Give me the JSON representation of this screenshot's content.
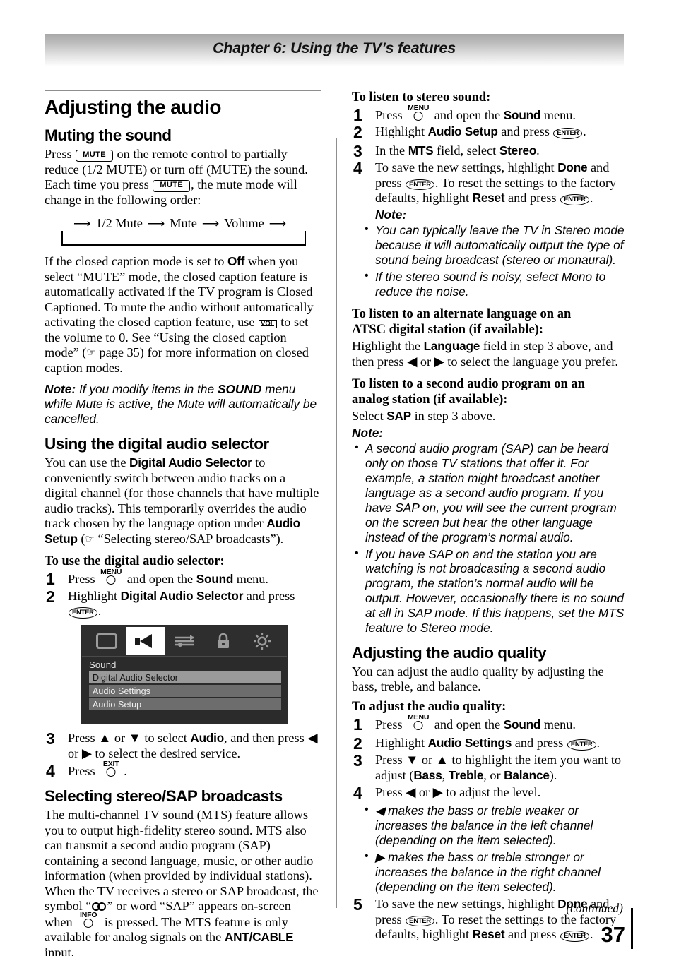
{
  "header": {
    "chapter_title": "Chapter 6: Using the TV’s features"
  },
  "left": {
    "section_title": "Adjusting the audio",
    "muting": {
      "heading": "Muting the sound",
      "p1_a": "Press",
      "key_mute": "MUTE",
      "p1_b": "on the remote control to partially reduce (1/2 MUTE) or turn off (MUTE) the sound. Each time you press",
      "p1_c": ", the mute mode will change in the following order:",
      "cycle": [
        "1/2 Mute",
        "Mute",
        "Volume"
      ],
      "p2_a": "If the closed caption mode is set to",
      "p2_off": "Off",
      "p2_b": "when you select “MUTE” mode, the closed caption feature is automatically activated if the TV program is Closed Captioned. To mute the audio without automatically activating the closed caption feature, use",
      "key_vol": "VOL",
      "p2_c": "to set the volume to 0. See “Using the closed caption mode” (",
      "p2_d": "page 35) for more information on closed caption modes.",
      "note_label": "Note:",
      "note_a": "If you modify items in the",
      "note_b": "SOUND",
      "note_c": "menu while Mute is active, the Mute will automatically be cancelled."
    },
    "selector": {
      "heading": "Using the digital audio selector",
      "p1_a": "You can use the",
      "p1_b": "Digital Audio Selector",
      "p1_c": "to conveniently switch between audio tracks on a digital channel (for those channels that have multiple audio tracks). This temporarily overrides the audio track chosen by the language option under",
      "p1_d": "Audio Setup",
      "p1_e": "(",
      "p1_f": "“Selecting stereo/SAP broadcasts”).",
      "task_heading": "To use the digital audio selector:",
      "step1_a": "Press",
      "step1_key": "MENU",
      "step1_b": "and open the",
      "step1_bold": "Sound",
      "step1_c": "menu.",
      "step2_a": "Highlight",
      "step2_bold": "Digital Audio Selector",
      "step2_b": "and press",
      "key_enter": "ENTER",
      "step2_c": ".",
      "step3_a": "Press",
      "step3_b": "or",
      "step3_c": "to select",
      "step3_bold": "Audio",
      "step3_d": ", and then press",
      "step3_e": "or",
      "step3_f": "to select the desired service.",
      "step4_a": "Press",
      "step4_key": "EXIT",
      "step4_b": "."
    },
    "osd": {
      "icons": [
        "picture-icon",
        "sound-icon",
        "settings-icon",
        "lock-icon",
        "brightness-icon"
      ],
      "active_icon_index": 1,
      "menu_title": "Sound",
      "rows": [
        "Digital Audio Selector",
        "Audio Settings",
        "Audio Setup"
      ],
      "selected_row_index": 0
    },
    "stereo_sap": {
      "heading": "Selecting stereo/SAP broadcasts",
      "p1_a": "The multi-channel TV sound (MTS) feature allows you to output high-fidelity stereo sound. MTS also can transmit a second audio program (SAP) containing a second language, music, or other audio information (when provided by individual stations). When the TV receives a stereo or SAP broadcast, the symbol “",
      "p1_b": "” or word “SAP” appears on-screen when",
      "info_key": "INFO",
      "p1_c": "is pressed. The MTS feature is only available for analog signals on the",
      "p1_bold": "ANT/CABLE",
      "p1_d": "input."
    }
  },
  "right": {
    "stereo_task": {
      "heading": "To listen to stereo sound:",
      "step1_a": "Press",
      "step1_key": "MENU",
      "step1_b": "and open the",
      "step1_bold": "Sound",
      "step1_c": "menu.",
      "step2_a": "Highlight",
      "step2_bold": "Audio Setup",
      "step2_b": "and press",
      "key_enter": "ENTER",
      "step2_c": ".",
      "step3_a": "In the",
      "step3_bold1": "MTS",
      "step3_b": "field, select",
      "step3_bold2": "Stereo",
      "step3_c": ".",
      "step4_a": "To save the new settings, highlight",
      "step4_bold1": "Done",
      "step4_b": "and press",
      "step4_c": ". To reset the settings to the factory defaults, highlight",
      "step4_bold2": "Reset",
      "step4_d": "and press",
      "step4_e": ".",
      "note_label": "Note:",
      "notes": [
        {
          "a": "You can typically leave the TV in ",
          "b": "Stereo",
          "c": " mode because it will automatically output the type of sound being broadcast (stereo or monaural)."
        },
        {
          "a": "If the stereo sound is noisy, select ",
          "b": "Mono",
          "c": " to reduce the noise."
        }
      ]
    },
    "alt_language": {
      "heading_line1": "To listen to an alternate language on an",
      "heading_line2": "ATSC digital station (if available):",
      "p_a": "Highlight the",
      "p_bold": "Language",
      "p_b": "field in step 3 above, and then press",
      "p_c": "or",
      "p_d": "to select the language you prefer."
    },
    "sap_task": {
      "heading_line1": "To listen to a second audio program on an",
      "heading_line2": "analog station (if available):",
      "p_a": "Select",
      "p_bold": "SAP",
      "p_b": "in step 3 above.",
      "note_label": "Note:",
      "note1": "A second audio program (SAP) can be heard only on those TV stations that offer it. For example, a station might broadcast another language as a second audio program. If you have SAP on, you will see the current program on the screen but hear the other language instead of the program’s normal audio.",
      "note2_a": "If you have SAP on and the station you are watching is not broadcasting a second audio program, the station’s normal audio will be output. However, occasionally there is no sound at all in ",
      "note2_b1": "SAP",
      "note2_c": " mode. If this happens, set the ",
      "note2_b2": "MTS",
      "note2_d": " feature to ",
      "note2_b3": "Stereo",
      "note2_e": " mode."
    },
    "audio_quality": {
      "heading": "Adjusting the audio quality",
      "intro": "You can adjust the audio quality by adjusting the bass, treble, and balance.",
      "task_heading": "To adjust the audio quality:",
      "step1_a": "Press",
      "step1_key": "MENU",
      "step1_b": "and open the",
      "step1_bold": "Sound",
      "step1_c": "menu.",
      "step2_a": "Highlight",
      "step2_bold": "Audio Settings",
      "step2_b": "and press",
      "key_enter": "ENTER",
      "step2_c": ".",
      "step3_a": "Press",
      "step3_b": "or",
      "step3_c": "to highlight the item you want to adjust (",
      "step3_bold1": "Bass",
      "step3_d": ", ",
      "step3_bold2": "Treble",
      "step3_e": ", or ",
      "step3_bold3": "Balance",
      "step3_f": ").",
      "step4_a": "Press",
      "step4_b": "or",
      "step4_c": "to adjust the level.",
      "bullets": [
        {
          "arrow": "◀",
          "text": " makes the bass or treble weaker or increases the balance in the left channel (depending on the item selected)."
        },
        {
          "arrow": "▶",
          "text": " makes the bass or treble stronger or increases the balance in the right channel (depending on the item selected)."
        }
      ],
      "step5_a": "To save the new settings, highlight",
      "step5_bold1": "Done",
      "step5_b": "and press",
      "step5_c": ". To reset the settings to the factory defaults, highlight",
      "step5_bold2": "Reset",
      "step5_d": "and press",
      "step5_e": "."
    }
  },
  "footer": {
    "continued": "(continued)",
    "page_number": "37"
  },
  "glyphs": {
    "up": "▲",
    "down": "▼",
    "left": "◀",
    "right": "▶",
    "hand": "☞",
    "arrow_right": "⟶"
  }
}
